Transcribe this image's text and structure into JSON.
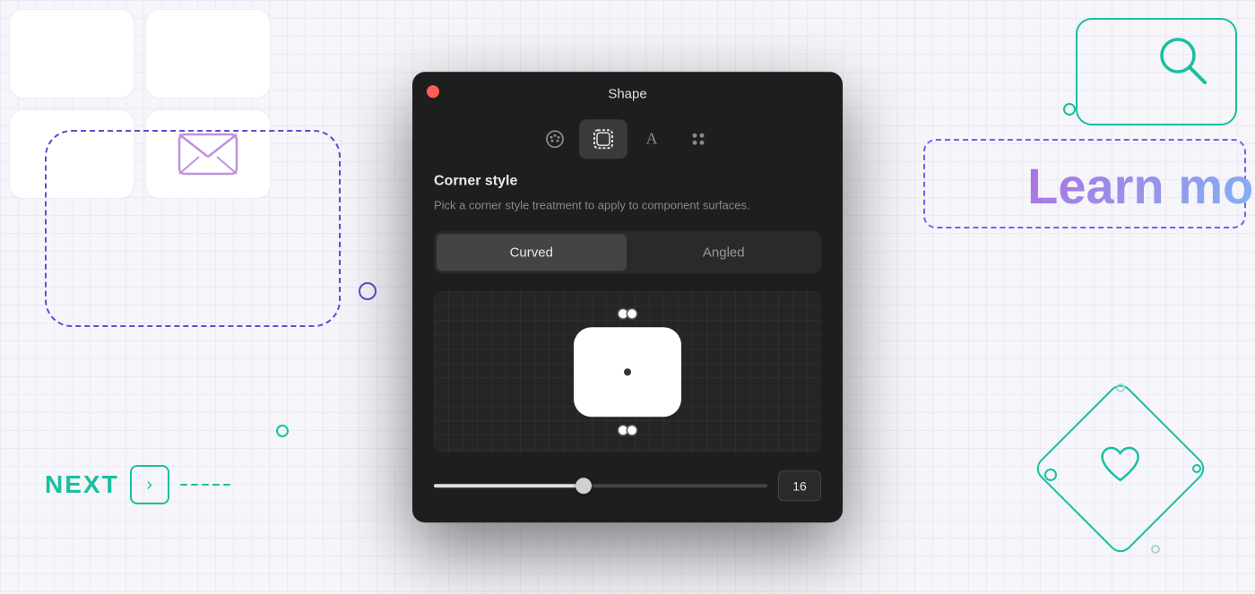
{
  "background": {
    "color": "#f0f0f8",
    "grid_color": "rgba(180,180,220,0.15)"
  },
  "modal": {
    "title": "Shape",
    "close_button_color": "#ff5f57",
    "tabs": [
      {
        "id": "palette",
        "icon": "🎨",
        "label": "palette-tab",
        "active": false
      },
      {
        "id": "shape",
        "icon": "⬜",
        "label": "shape-tab",
        "active": true
      },
      {
        "id": "text",
        "icon": "A",
        "label": "text-tab",
        "active": false
      },
      {
        "id": "more",
        "icon": "⋯",
        "label": "more-tab",
        "active": false
      }
    ],
    "section": {
      "title": "Corner style",
      "description": "Pick a corner style treatment to apply to component surfaces.",
      "toggle": {
        "option1": "Curved",
        "option2": "Angled",
        "selected": "Curved"
      },
      "slider": {
        "value": 16,
        "min": 0,
        "max": 100,
        "fill_percent": 45
      }
    }
  },
  "decorative": {
    "next_label": "NEXT",
    "learn_more_text": "Learn mor",
    "dot_purple_color": "#6b48d0",
    "teal_color": "#1abf9e",
    "purple_gradient_start": "#b06ee0",
    "purple_gradient_end": "#7eb8f7"
  }
}
